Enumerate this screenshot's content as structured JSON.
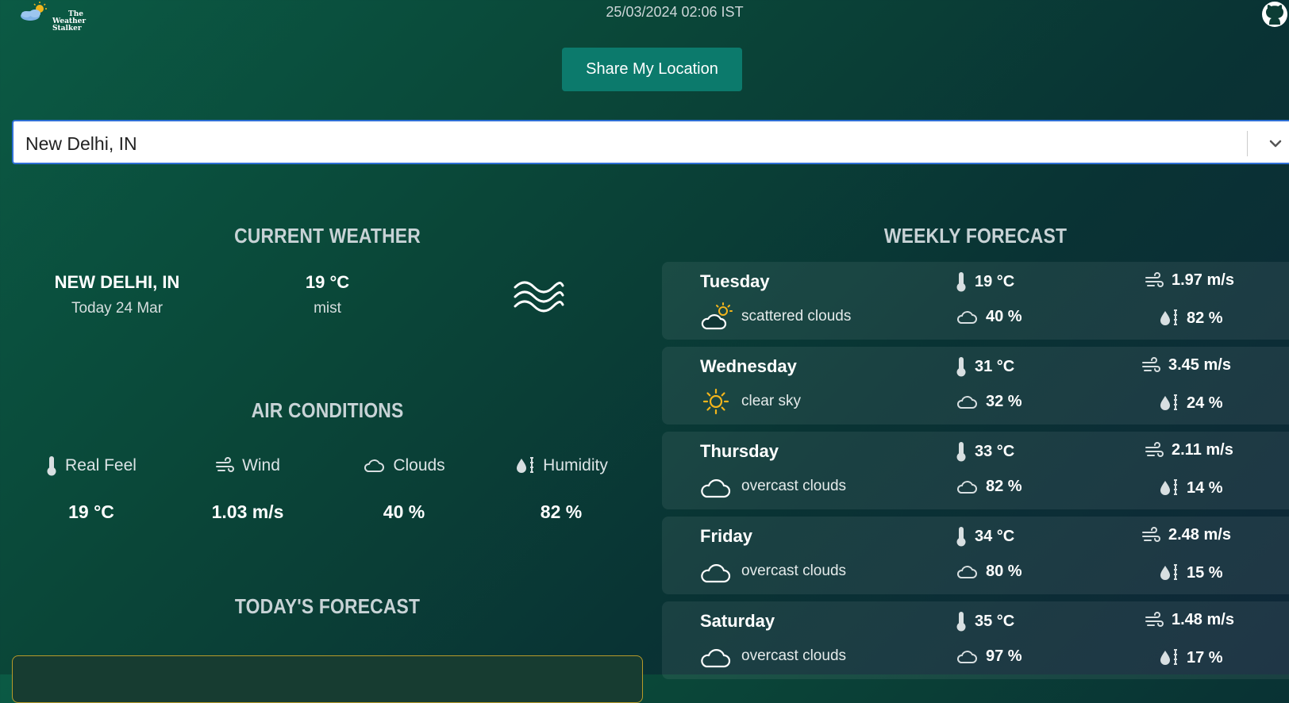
{
  "header": {
    "logo_line1": "The",
    "logo_line2": "Weather Stalker",
    "datetime": "25/03/2024 02:06 IST",
    "share_button": "Share My Location"
  },
  "search": {
    "value": "New Delhi, IN"
  },
  "current_weather": {
    "title": "CURRENT WEATHER",
    "city": "NEW DELHI, IN",
    "date": "Today 24 Mar",
    "temp": "19 °C",
    "description": "mist",
    "icon": "mist-icon"
  },
  "air_conditions": {
    "title": "AIR CONDITIONS",
    "items": [
      {
        "label": "Real Feel",
        "value": "19 °C",
        "icon": "thermometer-icon"
      },
      {
        "label": "Wind",
        "value": "1.03 m/s",
        "icon": "wind-icon"
      },
      {
        "label": "Clouds",
        "value": "40 %",
        "icon": "cloud-icon"
      },
      {
        "label": "Humidity",
        "value": "82 %",
        "icon": "humidity-icon"
      }
    ]
  },
  "todays_forecast": {
    "title": "TODAY'S FORECAST"
  },
  "weekly_forecast": {
    "title": "WEEKLY FORECAST",
    "days": [
      {
        "day": "Tuesday",
        "description": "scattered clouds",
        "temp": "19 °C",
        "wind": "1.97 m/s",
        "clouds": "40 %",
        "humidity": "82 %",
        "icon": "partly-cloudy-icon"
      },
      {
        "day": "Wednesday",
        "description": "clear sky",
        "temp": "31 °C",
        "wind": "3.45 m/s",
        "clouds": "32 %",
        "humidity": "24 %",
        "icon": "sun-icon"
      },
      {
        "day": "Thursday",
        "description": "overcast clouds",
        "temp": "33 °C",
        "wind": "2.11 m/s",
        "clouds": "82 %",
        "humidity": "14 %",
        "icon": "cloud-icon"
      },
      {
        "day": "Friday",
        "description": "overcast clouds",
        "temp": "34 °C",
        "wind": "2.48 m/s",
        "clouds": "80 %",
        "humidity": "15 %",
        "icon": "cloud-icon"
      },
      {
        "day": "Saturday",
        "description": "overcast clouds",
        "temp": "35 °C",
        "wind": "1.48 m/s",
        "clouds": "97 %",
        "humidity": "17 %",
        "icon": "cloud-icon"
      }
    ]
  },
  "colors": {
    "accent": "#0c7a6c",
    "background": "#0a4638",
    "select_border": "#2f6fd6",
    "sun": "#f2b51c"
  }
}
